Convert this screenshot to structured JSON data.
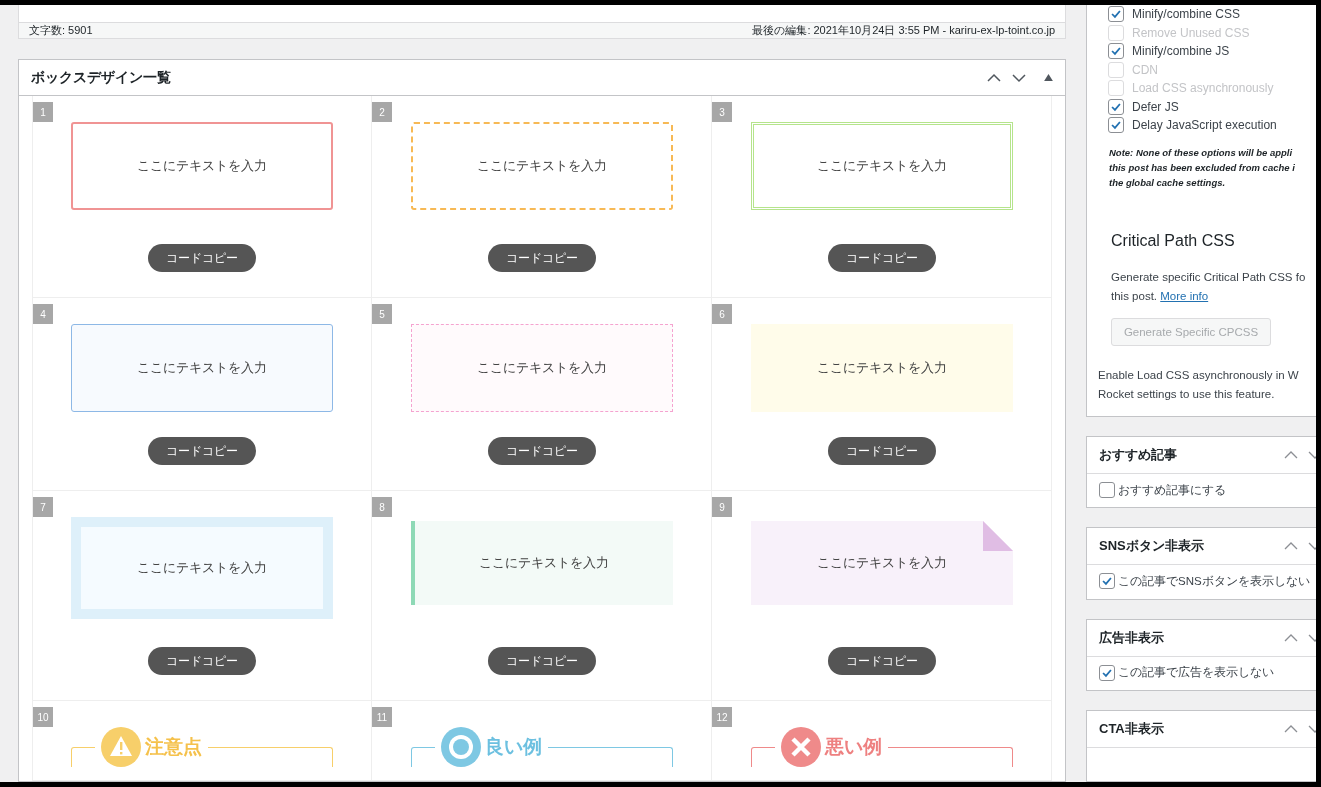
{
  "editor_status": {
    "word_count": "文字数: 5901",
    "last_edited": "最後の編集: 2021年10月24日 3:55 PM - kariru-ex-lp-toint.co.jp"
  },
  "box_panel": {
    "title": "ボックスデザイン一覧",
    "designs": [
      {
        "number": "1",
        "kind": "solid",
        "text": "ここにテキストを入力",
        "button": "コードコピー"
      },
      {
        "number": "2",
        "kind": "dashed",
        "text": "ここにテキストを入力",
        "button": "コードコピー"
      },
      {
        "number": "3",
        "kind": "double",
        "text": "ここにテキストを入力",
        "button": "コードコピー"
      },
      {
        "number": "4",
        "kind": "thin",
        "text": "ここにテキストを入力",
        "button": "コードコピー"
      },
      {
        "number": "5",
        "kind": "dotted",
        "text": "ここにテキストを入力",
        "button": "コードコピー"
      },
      {
        "number": "6",
        "kind": "filled",
        "text": "ここにテキストを入力",
        "button": "コードコピー"
      },
      {
        "number": "7",
        "kind": "thick",
        "text": "ここにテキストを入力",
        "button": "コードコピー"
      },
      {
        "number": "8",
        "kind": "leftbar",
        "text": "ここにテキストを入力",
        "button": "コードコピー"
      },
      {
        "number": "9",
        "kind": "folded",
        "text": "ここにテキストを入力",
        "button": "コードコピー"
      },
      {
        "number": "10",
        "kind": "caution",
        "heading": "注意点"
      },
      {
        "number": "11",
        "kind": "good",
        "heading": "良い例"
      },
      {
        "number": "12",
        "kind": "bad",
        "heading": "悪い例"
      }
    ]
  },
  "sidebar": {
    "rocket_options": [
      {
        "label": "Minify/combine CSS",
        "checked": true,
        "disabled": false
      },
      {
        "label": "Remove Unused CSS",
        "checked": false,
        "disabled": true
      },
      {
        "label": "Minify/combine JS",
        "checked": true,
        "disabled": false
      },
      {
        "label": "CDN",
        "checked": false,
        "disabled": true
      },
      {
        "label": "Load CSS asynchronously",
        "checked": false,
        "disabled": true
      },
      {
        "label": "Defer JS",
        "checked": true,
        "disabled": false
      },
      {
        "label": "Delay JavaScript execution",
        "checked": true,
        "disabled": false
      }
    ],
    "note_lines": [
      "Note: None of these options will be appli",
      "this post has been excluded from cache i",
      "the global cache settings."
    ],
    "cpcss": {
      "title": "Critical Path CSS",
      "description_lines": [
        "Generate specific Critical Path CSS fo",
        "this post."
      ],
      "link": "More info",
      "button": "Generate Specific CPCSS",
      "notice_lines": [
        "Enable Load CSS asynchronously in W",
        "Rocket settings to use this feature."
      ]
    },
    "meta_boxes": [
      {
        "title": "おすすめ記事",
        "option": {
          "label": "おすすめ記事にする",
          "checked": false
        }
      },
      {
        "title": "SNSボタン非表示",
        "option": {
          "label": "この記事でSNSボタンを表示しない",
          "checked": true
        }
      },
      {
        "title": "広告非表示",
        "option": {
          "label": "この記事で広告を表示しない",
          "checked": true
        }
      },
      {
        "title": "CTA非表示"
      }
    ]
  }
}
